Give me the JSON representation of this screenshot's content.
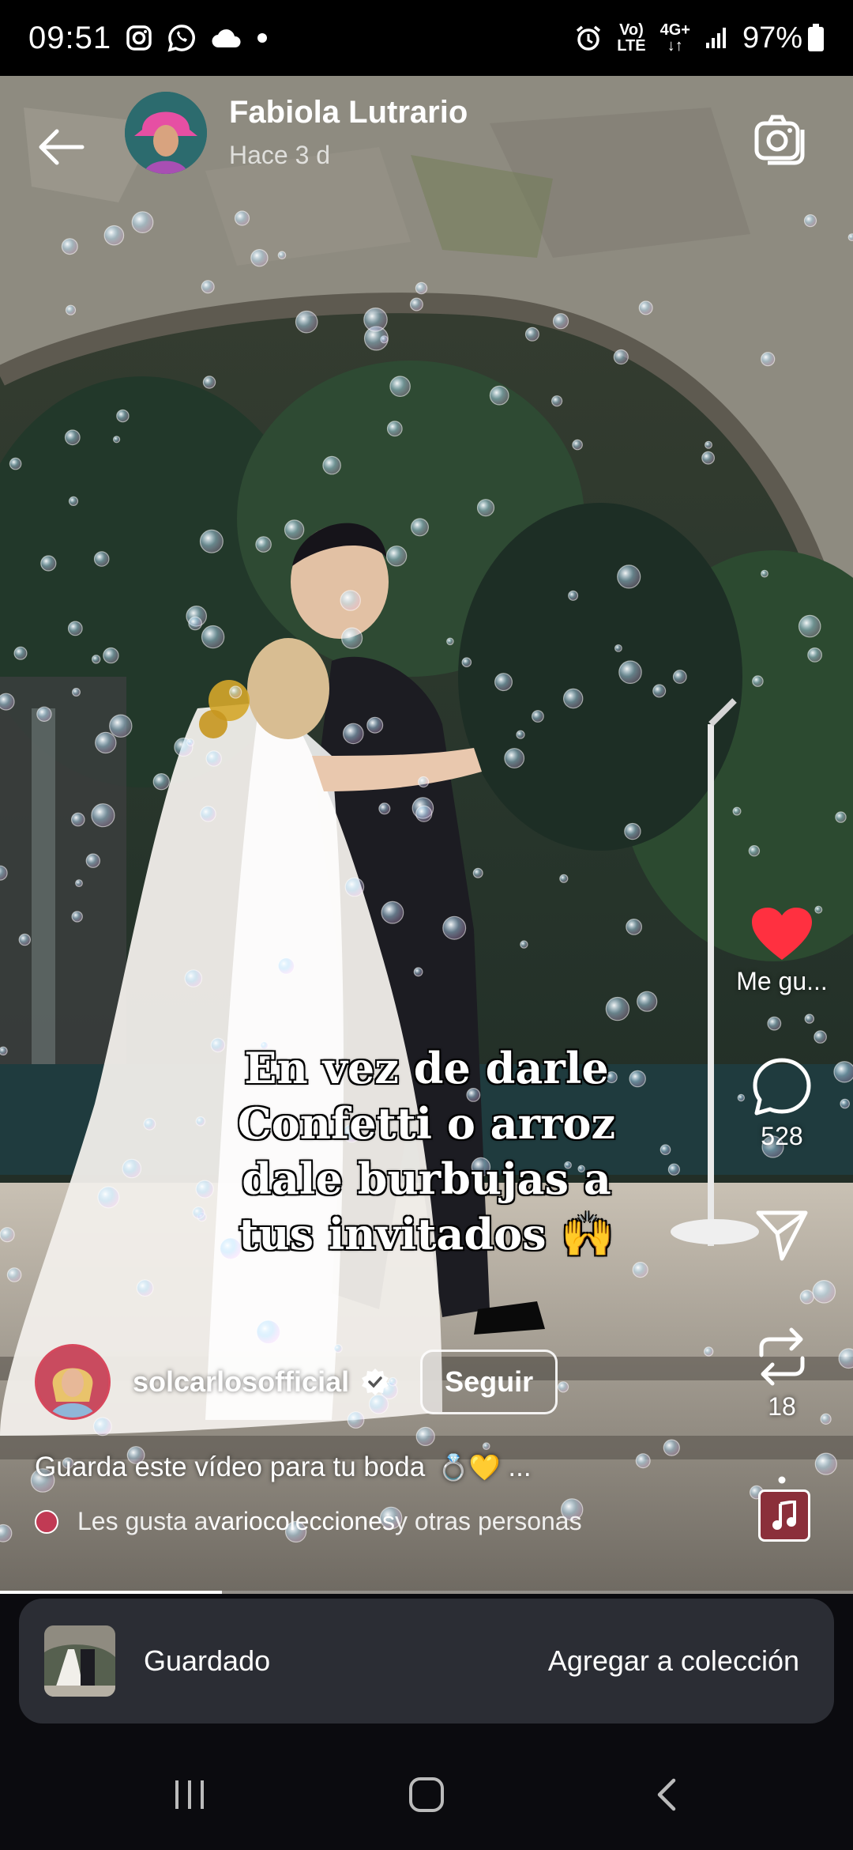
{
  "status_bar": {
    "time": "09:51",
    "left_icons": [
      "instagram-icon",
      "whatsapp-icon",
      "cloud-icon",
      "dot-icon"
    ],
    "volte_top": "Vo)",
    "volte_bottom": "LTE",
    "network": "4G+",
    "battery": "97%"
  },
  "header": {
    "account_name": "Fabiola Lutrario",
    "posted_ago": "Hace 3 d",
    "back_icon": "back-arrow-icon",
    "camera_icon": "camera-icon"
  },
  "video": {
    "overlay_lines": [
      "En vez de darle",
      "Confetti o arroz",
      "dale burbujas a",
      "tus invitados 🙌"
    ]
  },
  "actions": {
    "like_label": "Me gu...",
    "comments_count": "528",
    "reposts_count": "18",
    "accent_like": "#ff3040"
  },
  "author": {
    "username": "solcarlosofficial",
    "follow_label": "Seguir",
    "caption": "Guarda este vídeo para tu boda",
    "caption_emoji": "💍💛",
    "caption_more": "...",
    "likes_prefix": "Les gusta a ",
    "likes_user": "variocolecciones",
    "likes_suffix": " y otras personas"
  },
  "progress": {
    "fraction": 0.26
  },
  "toast": {
    "label": "Guardado",
    "action": "Agregar a colección"
  },
  "navbar": {
    "recents_icon": "recent-apps-icon",
    "home_icon": "home-icon",
    "back_icon": "back-icon"
  }
}
